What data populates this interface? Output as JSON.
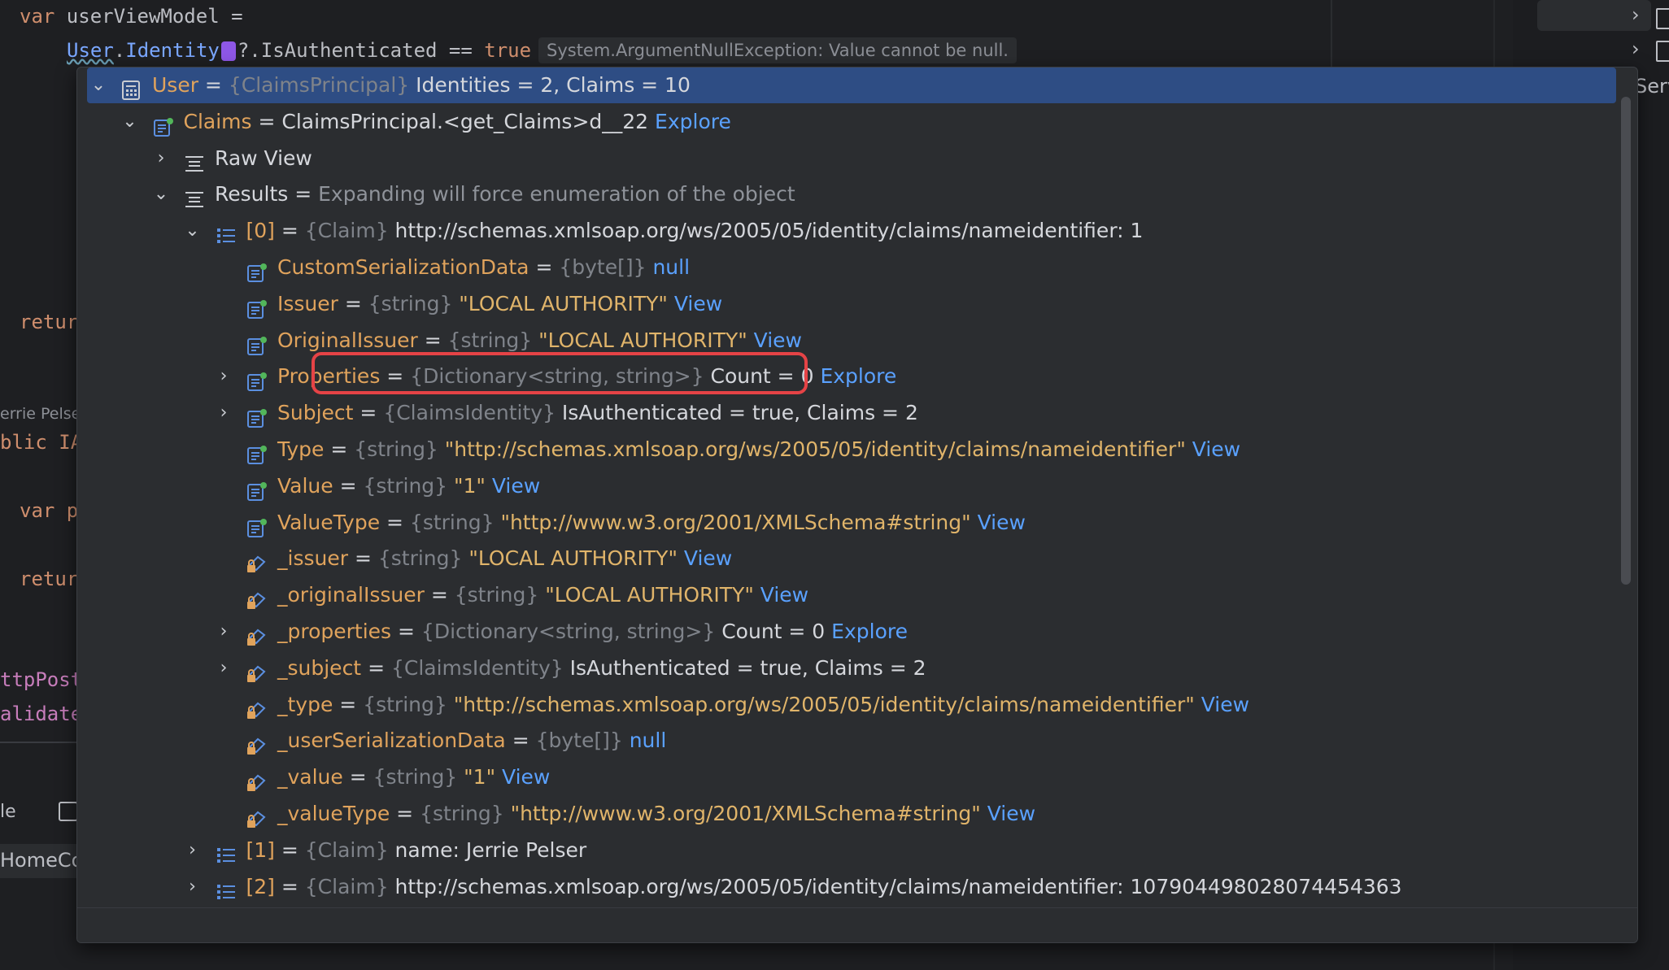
{
  "editor": {
    "line1_kw": "var",
    "line1_rest": " userViewModel =",
    "line2_user": "User",
    "line2_dot": ".",
    "line2_identity": "Identity",
    "line2_rest": "?.IsAuthenticated == ",
    "line2_true": "true",
    "inline_exception": "System.ArgumentNullException: Value cannot be null.",
    "fragments": {
      "retur1": "retur",
      "author": "errie Pelse",
      "lic": "blic IA",
      "varp": "var p",
      "retur2": "retur",
      "httppost": "ttpPost",
      "validate": "alidate",
      "le": "le",
      "homeco": "HomeCo",
      "serv": "Serv"
    }
  },
  "colors": {
    "selected_row": "#2e4d84",
    "highlight_border": "#e54346",
    "link": "#5aa1ff",
    "field_name": "#e0a35c"
  },
  "rows": [
    {
      "chev": "⌄",
      "icon": "calculator-icon",
      "name": "User",
      "eq": " = ",
      "type": "{ClaimsPrincipal}",
      "val": " Identities = 2, Claims = 10",
      "link": "",
      "selected": true
    },
    {
      "chev": "⌄",
      "icon": "property-icon",
      "name": "Claims",
      "eq": " = ",
      "type": "",
      "val": "ClaimsPrincipal.<get_Claims>d__22 ",
      "link": "Explore"
    },
    {
      "chev": "›",
      "icon": "list-view-icon",
      "name": "Raw View",
      "eq": "",
      "type": "",
      "val": "",
      "link": "",
      "plainname": true
    },
    {
      "chev": "⌄",
      "icon": "list-view-icon",
      "name": "Results",
      "eq": " = ",
      "type": "",
      "val": "",
      "hint": "Expanding will force enumeration of the object",
      "link": "",
      "plainname": true
    },
    {
      "chev": "⌄",
      "icon": "array-icon",
      "name": "[0]",
      "eq": " = ",
      "type": "{Claim}",
      "val": " http://schemas.xmlsoap.org/ws/2005/05/identity/claims/nameidentifier: 1",
      "link": ""
    },
    {
      "chev": "",
      "icon": "property-icon",
      "name": "CustomSerializationData",
      "eq": " = ",
      "type": "{byte[]}",
      "val": "",
      "link": " null"
    },
    {
      "chev": "",
      "icon": "property-icon",
      "name": "Issuer",
      "eq": " = ",
      "type": "{string}",
      "str": " \"LOCAL AUTHORITY\"",
      "link": " View"
    },
    {
      "chev": "",
      "icon": "property-icon",
      "name": "OriginalIssuer",
      "eq": " = ",
      "type": "{string}",
      "str": " \"LOCAL AUTHORITY\"",
      "link": " View"
    },
    {
      "chev": "›",
      "icon": "property-icon",
      "name": "Properties",
      "eq": " = ",
      "type": "{Dictionary<string, string>}",
      "val": " Count = 0 ",
      "link": "Explore"
    },
    {
      "chev": "›",
      "icon": "property-icon",
      "name": "Subject",
      "eq": " = ",
      "type": "{ClaimsIdentity}",
      "val": " IsAuthenticated = true, Claims = 2",
      "link": ""
    },
    {
      "chev": "",
      "icon": "property-icon",
      "name": "Type",
      "eq": " = ",
      "type": "{string}",
      "str": " \"http://schemas.xmlsoap.org/ws/2005/05/identity/claims/nameidentifier\"",
      "link": " View"
    },
    {
      "chev": "",
      "icon": "property-icon",
      "name": "Value",
      "eq": " = ",
      "type": "{string}",
      "str": " \"1\"",
      "link": " View"
    },
    {
      "chev": "",
      "icon": "property-icon",
      "name": "ValueType",
      "eq": " = ",
      "type": "{string}",
      "str": " \"http://www.w3.org/2001/XMLSchema#string\"",
      "link": " View"
    },
    {
      "chev": "",
      "icon": "private-field-icon",
      "name": "_issuer",
      "eq": " = ",
      "type": "{string}",
      "str": " \"LOCAL AUTHORITY\"",
      "link": " View"
    },
    {
      "chev": "",
      "icon": "private-field-icon",
      "name": "_originalIssuer",
      "eq": " = ",
      "type": "{string}",
      "str": " \"LOCAL AUTHORITY\"",
      "link": " View"
    },
    {
      "chev": "›",
      "icon": "private-field-icon",
      "name": "_properties",
      "eq": " = ",
      "type": "{Dictionary<string, string>}",
      "val": " Count = 0 ",
      "link": "Explore"
    },
    {
      "chev": "›",
      "icon": "private-field-icon",
      "name": "_subject",
      "eq": " = ",
      "type": "{ClaimsIdentity}",
      "val": " IsAuthenticated = true, Claims = 2",
      "link": ""
    },
    {
      "chev": "",
      "icon": "private-field-icon",
      "name": "_type",
      "eq": " = ",
      "type": "{string}",
      "str": " \"http://schemas.xmlsoap.org/ws/2005/05/identity/claims/nameidentifier\"",
      "link": " View"
    },
    {
      "chev": "",
      "icon": "private-field-icon",
      "name": "_userSerializationData",
      "eq": " = ",
      "type": "{byte[]}",
      "val": "",
      "link": " null"
    },
    {
      "chev": "",
      "icon": "private-field-icon",
      "name": "_value",
      "eq": " = ",
      "type": "{string}",
      "str": " \"1\"",
      "link": " View"
    },
    {
      "chev": "",
      "icon": "private-field-icon",
      "name": "_valueType",
      "eq": " = ",
      "type": "{string}",
      "str": " \"http://www.w3.org/2001/XMLSchema#string\"",
      "link": " View"
    },
    {
      "chev": "›",
      "icon": "array-icon",
      "name": "[1]",
      "eq": " = ",
      "type": "{Claim}",
      "val": " name: Jerrie Pelser",
      "link": ""
    },
    {
      "chev": "›",
      "icon": "array-icon",
      "name": "[2]",
      "eq": " = ",
      "type": "{Claim}",
      "val": " http://schemas.xmlsoap.org/ws/2005/05/identity/claims/nameidentifier: 107904498028074454363",
      "link": ""
    }
  ]
}
